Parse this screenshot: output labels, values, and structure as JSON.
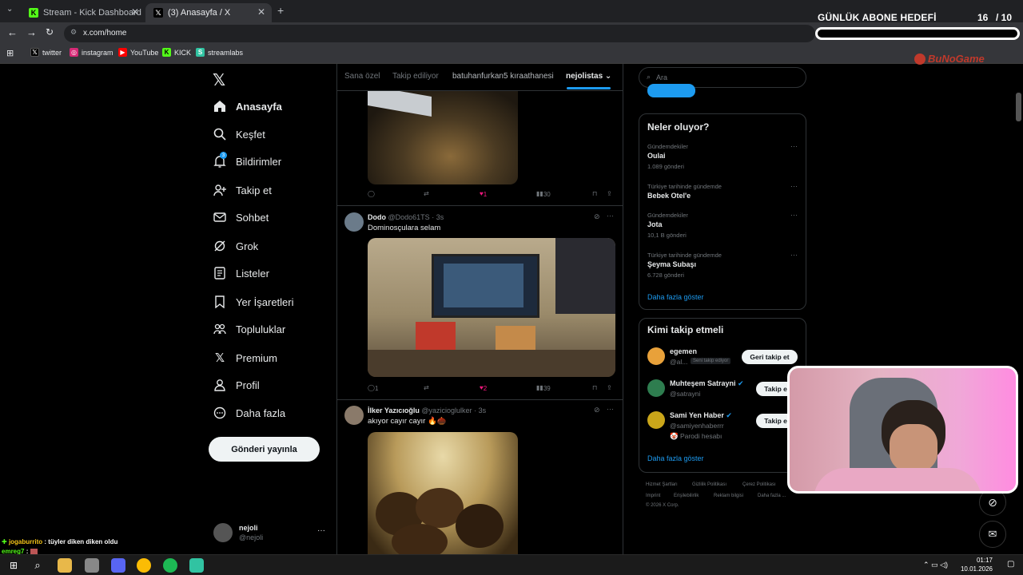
{
  "browser": {
    "tabs": [
      {
        "title": "Stream - Kick Dashboard",
        "favicon_color": "#53fc18"
      },
      {
        "title": "(3) Anasayfa / X",
        "favicon_color": "#000000"
      }
    ],
    "url": "x.com/home",
    "bookmarks": [
      {
        "label": "twitter",
        "icon": "x-icon"
      },
      {
        "label": "instagram",
        "icon": "instagram-icon"
      },
      {
        "label": "YouTube",
        "icon": "youtube-icon"
      },
      {
        "label": "KICK",
        "icon": "kick-icon"
      },
      {
        "label": "streamlabs",
        "icon": "streamlabs-icon"
      }
    ]
  },
  "overlay": {
    "goal_title": "GÜNLÜK ABONE HEDEFİ",
    "goal_current": "16",
    "goal_target": "/ 10",
    "brand": "BuNoGame",
    "chat": [
      {
        "user": "jogaburrito",
        "message": "tüyler diken diken oldu"
      },
      {
        "user": "emreg7",
        "message": ""
      }
    ]
  },
  "nav": {
    "items": [
      {
        "label": "Anasayfa",
        "icon": "home-icon"
      },
      {
        "label": "Keşfet",
        "icon": "search-icon"
      },
      {
        "label": "Bildirimler",
        "icon": "bell-icon",
        "badge": "3"
      },
      {
        "label": "Takip et",
        "icon": "follow-icon"
      },
      {
        "label": "Sohbet",
        "icon": "mail-icon"
      },
      {
        "label": "Grok",
        "icon": "grok-icon"
      },
      {
        "label": "Listeler",
        "icon": "list-icon"
      },
      {
        "label": "Yer İşaretleri",
        "icon": "bookmark-icon"
      },
      {
        "label": "Topluluklar",
        "icon": "communities-icon"
      },
      {
        "label": "Premium",
        "icon": "x-icon"
      },
      {
        "label": "Profil",
        "icon": "profile-icon"
      },
      {
        "label": "Daha fazla",
        "icon": "more-icon"
      }
    ],
    "post_button": "Gönderi yayınla",
    "account": {
      "name": "nejoli",
      "handle": "@nejoli"
    }
  },
  "feed": {
    "tabs": [
      "Sana özel",
      "Takip ediliyor",
      "batuhanfurkan5 kıraathanesi",
      "nejolistas"
    ],
    "first_actions": {
      "likes": "1",
      "views": "30"
    },
    "tweets": [
      {
        "name": "Dodo",
        "handle": "@Dodo61TS",
        "time": "· 3s",
        "text": "Dominosçulara selam",
        "replies": "1",
        "likes": "2",
        "views": "39"
      },
      {
        "name": "İlker Yazıcıoğlu",
        "handle": "@yazicioglulker",
        "time": "· 3s",
        "text": "akıyor cayır cayır 🔥🌰"
      }
    ]
  },
  "right": {
    "search_placeholder": "Ara",
    "trending_title": "Neler oluyor?",
    "trends": [
      {
        "context": "Gündemdekiler",
        "name": "Oulai",
        "count": "1.089 gönderi"
      },
      {
        "context": "Türkiye tarihinde gündemde",
        "name": "Bebek Otel'e",
        "count": ""
      },
      {
        "context": "Gündemdekiler",
        "name": "Jota",
        "count": "10,1 B gönderi"
      },
      {
        "context": "Türkiye tarihinde gündemde",
        "name": "Şeyma Subaşı",
        "count": "6.728 gönderi"
      }
    ],
    "show_more": "Daha fazla göster",
    "who_title": "Kimi takip etmeli",
    "who": [
      {
        "name": "egemen",
        "handle": "@al...",
        "badge": "Seni takip ediyor",
        "button": "Geri takip et"
      },
      {
        "name": "Muhteşem Satrayni",
        "handle": "@satrayni",
        "button": "Takip et"
      },
      {
        "name": "Sami Yen Haber",
        "handle": "@samiyenhaberrr",
        "extra": "🤡 Parodi hesabı",
        "button": "Takip et"
      }
    ],
    "footer": [
      "Hizmet Şartları",
      "Gizlilik Politikası",
      "Çerez Politikası",
      "Imprint",
      "Erişilebilirlik",
      "Reklam bilgisi",
      "Daha fazla ...",
      "© 2026 X Corp."
    ]
  },
  "taskbar": {
    "time": "01:17",
    "date": "10.01.2026"
  }
}
